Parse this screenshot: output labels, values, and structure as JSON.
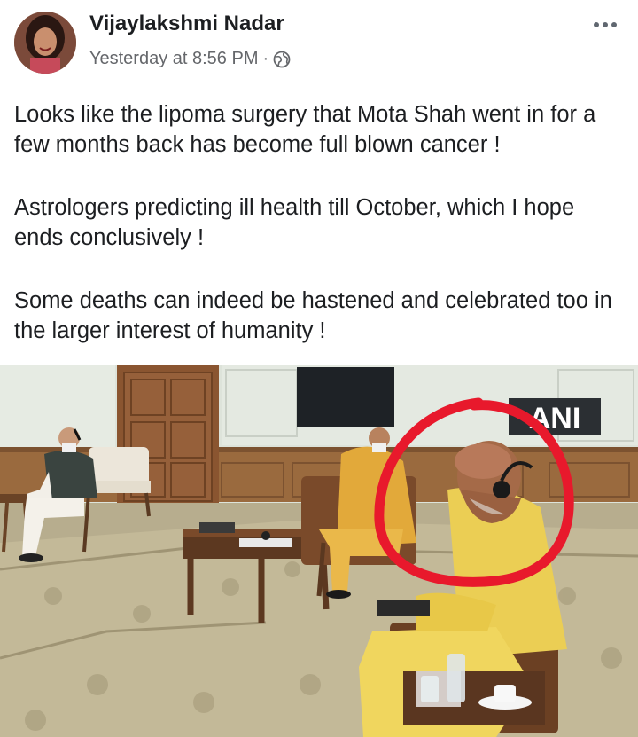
{
  "post": {
    "author": "Vijaylakshmi Nadar",
    "timestamp": "Yesterday at 8:56 PM",
    "separator": "·",
    "privacy_icon": "globe-icon",
    "menu_icon": "more-options-icon",
    "paragraphs": [
      "Looks like the lipoma surgery that Mota Shah went in for a few months back has become full blown cancer !",
      "Astrologers predicting ill health till October, which I hope ends conclusively !",
      "Some deaths can indeed be hastened and celebrated too in the larger interest of humanity !"
    ]
  },
  "photo": {
    "watermark": "ANI",
    "annotation_color": "#e8192c"
  },
  "colors": {
    "author_text": "#1c1e21",
    "meta_text": "#65676b",
    "background": "#ffffff"
  }
}
